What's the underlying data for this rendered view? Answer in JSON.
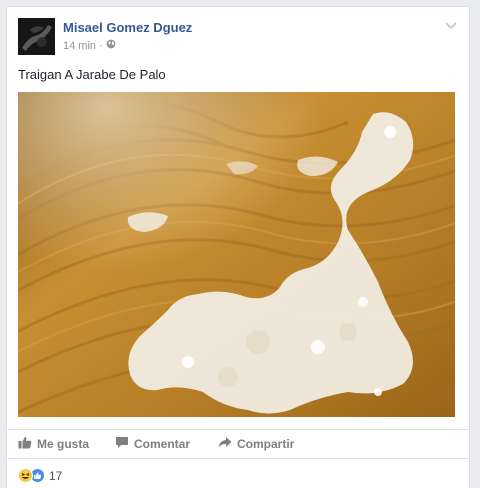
{
  "post": {
    "author": "Misael Gomez Dguez",
    "time": "14 min",
    "audience_icon": "globe-icon",
    "message": "Traigan A Jarabe De Palo",
    "photo": {
      "description_icon": "photo-spilled-liquid",
      "colors": {
        "wood": "#b8802a",
        "foam": "#f1ece2"
      }
    }
  },
  "actions": {
    "like_label": "Me gusta",
    "comment_label": "Comentar",
    "share_label": "Compartir"
  },
  "reactions": {
    "types": [
      "haha",
      "like"
    ],
    "count": "17"
  },
  "colors": {
    "author": "#365899",
    "meta": "#90949c",
    "action": "#7f7f7f",
    "page_bg": "#e9ebee"
  }
}
